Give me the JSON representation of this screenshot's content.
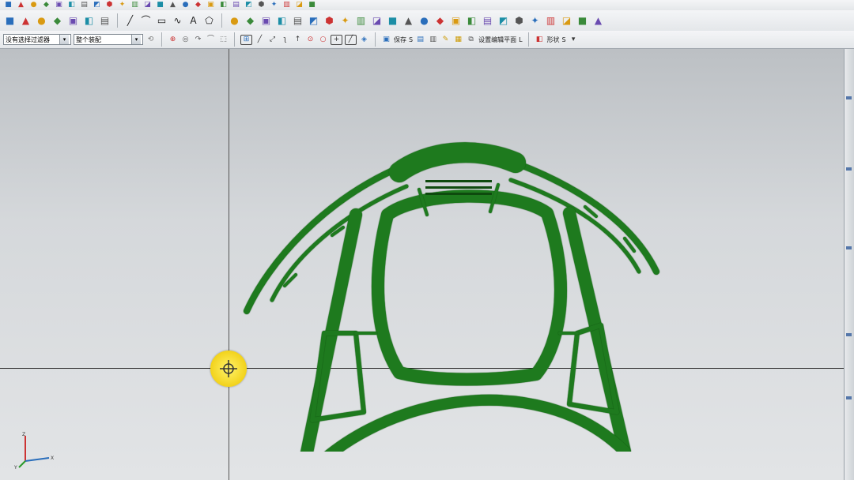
{
  "toolbar_top": {
    "icons": [
      "cube-icon",
      "settings-icon",
      "model-icon",
      "globe-icon",
      "block-icon",
      "window-icon",
      "pencil-icon",
      "gear-icon",
      "box-icon",
      "sheet-icon",
      "feature-icon",
      "flag-icon",
      "layer-icon",
      "blend-icon",
      "save-icon",
      "move-icon",
      "view-icon",
      "plug-icon",
      "image-icon",
      "tool-icon",
      "table-icon",
      "rotate-icon",
      "select-icon",
      "chart-icon",
      "more-icon"
    ]
  },
  "toolbar_sketch": {
    "left_icons": [
      "snap-icon",
      "pick-icon",
      "shape-icon",
      "fill-icon",
      "line-style-icon",
      "measure-icon",
      "dimension-icon"
    ],
    "draw_tools": [
      "line-icon",
      "arc-icon",
      "rectangle-icon",
      "spline-icon",
      "text-icon",
      "shape-icon"
    ],
    "feature_tools": [
      "extrude-icon",
      "revolve-icon",
      "hole-icon",
      "boss-icon",
      "pocket-icon",
      "chamfer-icon",
      "blend-icon",
      "shell-icon",
      "trim-icon",
      "pattern-icon",
      "mirror-icon",
      "unite-icon",
      "subtract-icon",
      "intersect-icon",
      "offset-icon",
      "thicken-icon",
      "scale-icon",
      "wrap-icon",
      "sew-icon",
      "patch-icon",
      "replace-icon",
      "move-face-icon",
      "resize-icon",
      "delete-face-icon"
    ],
    "icon_glyphs": {
      "text-icon": "A"
    }
  },
  "selection_bar": {
    "filter": {
      "value": "没有选择过滤器",
      "arrow": "▾"
    },
    "scope": {
      "value": "整个装配",
      "arrow": "▾"
    },
    "save_label": "保存",
    "save_hotkey": "S",
    "plane_label": "设置编辑平面",
    "plane_hotkey": "L",
    "shape_label": "形状",
    "shape_hotkey": "S"
  },
  "viewport": {
    "background_top": "#bcc0c4",
    "background_bottom": "#e2e4e6",
    "part_color": "#1e7a1e",
    "part_edge": "#0e4a0e",
    "part_highlight": "#2f9a2f",
    "triad": {
      "x_label": "X",
      "y_label": "Y",
      "z_label": "Z"
    }
  },
  "colors": {
    "cursor": "#f2d21b",
    "toolbar_accent": "#2a6ebb"
  }
}
